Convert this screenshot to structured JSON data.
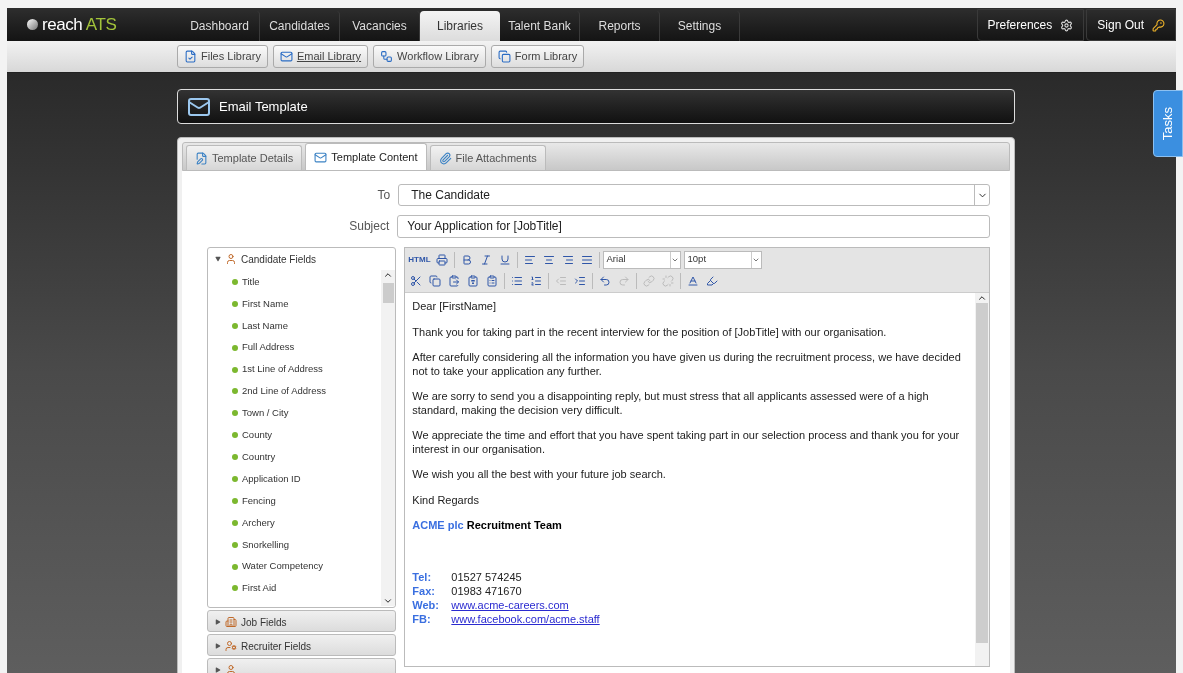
{
  "logo": {
    "word": "reach",
    "accent": "ATS"
  },
  "nav": [
    {
      "label": "Dashboard",
      "selected": false
    },
    {
      "label": "Candidates",
      "selected": false
    },
    {
      "label": "Vacancies",
      "selected": false
    },
    {
      "label": "Libraries",
      "selected": true
    },
    {
      "label": "Talent Bank",
      "selected": false
    },
    {
      "label": "Reports",
      "selected": false
    },
    {
      "label": "Settings",
      "selected": false
    }
  ],
  "user_menu": [
    {
      "label": "Preferences",
      "kind": "gear"
    },
    {
      "label": "Sign Out",
      "kind": "key"
    }
  ],
  "sub_nav": [
    {
      "label": "Files Library",
      "kind": "file",
      "selected": false
    },
    {
      "label": "Email Library",
      "kind": "mail",
      "selected": true
    },
    {
      "label": "Workflow Library",
      "kind": "workflow",
      "selected": false
    },
    {
      "label": "Form Library",
      "kind": "form",
      "selected": false
    }
  ],
  "header": {
    "title": "Email Template"
  },
  "side_tab": {
    "label": "Tasks"
  },
  "tabs": [
    {
      "label": "Template Details",
      "kind": "edit",
      "selected": false
    },
    {
      "label": "Template Content",
      "kind": "mail",
      "selected": true
    },
    {
      "label": "File Attachments",
      "kind": "clip",
      "selected": false
    }
  ],
  "to": {
    "label": "To",
    "value": "The Candidate"
  },
  "subject": {
    "label": "Subject",
    "value": "Your Application for [JobTitle]"
  },
  "field_groups": [
    {
      "title": "Candidate Fields",
      "kind": "person",
      "expanded": true,
      "items": [
        "Title",
        "First Name",
        "Last Name",
        "Full Address",
        "1st Line of Address",
        "2nd Line of Address",
        "Town / City",
        "County",
        "Country",
        "Application ID",
        "Fencing",
        "Archery",
        "Snorkelling",
        "Water Competency",
        "First Aid"
      ]
    },
    {
      "title": "Job Fields",
      "kind": "building",
      "expanded": false
    },
    {
      "title": "Recruiter Fields",
      "kind": "recruiter",
      "expanded": false
    },
    {
      "kind": "person",
      "expanded": false
    }
  ],
  "toolbar": [
    [
      {
        "kind": "html",
        "label": "HTML",
        "disabled": false
      },
      {
        "kind": "print",
        "disabled": false
      },
      {
        "kind": "sep"
      },
      {
        "kind": "bold",
        "disabled": false
      },
      {
        "kind": "italic",
        "disabled": false
      },
      {
        "kind": "underline",
        "disabled": false
      },
      {
        "kind": "sep"
      },
      {
        "kind": "align-left",
        "disabled": false
      },
      {
        "kind": "align-center",
        "disabled": false
      },
      {
        "kind": "align-right",
        "disabled": false
      },
      {
        "kind": "justify",
        "disabled": false
      },
      {
        "kind": "sep"
      },
      {
        "kind": "font",
        "value": "Arial"
      },
      {
        "kind": "size",
        "value": "10pt"
      }
    ],
    [
      {
        "kind": "cut",
        "disabled": false
      },
      {
        "kind": "copy",
        "disabled": false
      },
      {
        "kind": "paste",
        "disabled": false
      },
      {
        "kind": "paste-text",
        "disabled": false
      },
      {
        "kind": "paste-word",
        "disabled": false
      },
      {
        "kind": "sep"
      },
      {
        "kind": "bullets",
        "disabled": false
      },
      {
        "kind": "numbers",
        "disabled": false
      },
      {
        "kind": "sep"
      },
      {
        "kind": "outdent",
        "disabled": true
      },
      {
        "kind": "indent",
        "disabled": false
      },
      {
        "kind": "sep"
      },
      {
        "kind": "undo",
        "disabled": false
      },
      {
        "kind": "redo",
        "disabled": true
      },
      {
        "kind": "sep"
      },
      {
        "kind": "link",
        "disabled": true
      },
      {
        "kind": "unlink",
        "disabled": true
      },
      {
        "kind": "sep"
      },
      {
        "kind": "text-color",
        "disabled": false
      },
      {
        "kind": "highlight",
        "disabled": false
      }
    ]
  ],
  "body": {
    "paragraphs": [
      "Dear [FirstName]",
      "Thank you for taking part in the recent interview for the position of [JobTitle] with our organisation.",
      "After carefully considering all the information you have given us during the recruitment process, we have decided not to take your application any further.",
      "We are sorry to send you a disappointing reply, but must stress that all applicants assessed were of a high standard, making the decision very difficult.",
      "We appreciate the time and effort that you have spent taking part in our selection process and thank you for your interest in our organisation.",
      "We wish you all the best with your future job search.",
      "Kind Regards"
    ]
  },
  "signature": {
    "company": "ACME plc",
    "team": "Recruitment Team"
  },
  "contacts": [
    {
      "label": "Tel:",
      "value": "01527 574245",
      "kind": "text"
    },
    {
      "label": "Fax:",
      "value": "01983 471670",
      "kind": "text"
    },
    {
      "label": "Web:",
      "value": "www.acme-careers.com",
      "kind": "link"
    },
    {
      "label": "FB:",
      "value": "www.facebook.com/acme.staff",
      "kind": "link"
    }
  ]
}
